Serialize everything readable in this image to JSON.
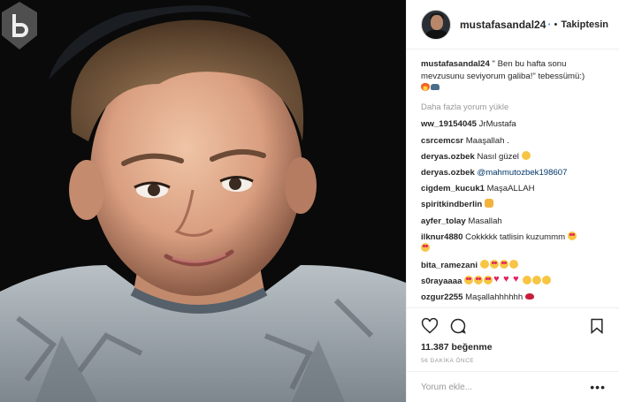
{
  "post": {
    "photo_alt": "smiling child in grey t-shirt"
  },
  "header": {
    "username": "mustafasandal24",
    "verified_icon": "verified-badge-icon",
    "separator": "•",
    "follow_label": "Takiptesin"
  },
  "caption": {
    "username": "mustafasandal24",
    "text": "\" Ben bu hafta sonu mevzusunu seviyorum galiba!\" tebessümü:)"
  },
  "load_more_label": "Daha fazla yorum yükle",
  "comments": [
    {
      "user": "ww_19154045",
      "text": "JrMustafa"
    },
    {
      "user": "csrcemcsr",
      "text": "Maaşallah ."
    },
    {
      "user": "deryas.ozbek",
      "text": "Nasıl güzel"
    },
    {
      "user": "deryas.ozbek",
      "text": "@mahmutozbek198607"
    },
    {
      "user": "cigdem_kucuk1",
      "text": "MaşaALLAH"
    },
    {
      "user": "spiritkindberlin",
      "text": ""
    },
    {
      "user": "ayfer_tolay",
      "text": "Masallah"
    },
    {
      "user": "ilknur4880",
      "text": "Cokkkkk tatlisin kuzummm"
    },
    {
      "user": "bita_ramezani",
      "text": ""
    },
    {
      "user": "s0rayaaaa",
      "text": ""
    },
    {
      "user": "ozgur2255",
      "text": "Maşallahhhhhh"
    }
  ],
  "actions": {
    "like_icon": "heart-outline-icon",
    "comment_icon": "comment-bubble-icon",
    "save_icon": "bookmark-icon",
    "likes_count": "11.387",
    "likes_label": "beğenme",
    "timestamp": "56 DAKİKA ÖNCE"
  },
  "add_comment": {
    "placeholder": "Yorum ekle...",
    "more_label": "•••"
  },
  "colors": {
    "link": "#003569",
    "muted": "#999999",
    "verified": "#3897f0"
  }
}
